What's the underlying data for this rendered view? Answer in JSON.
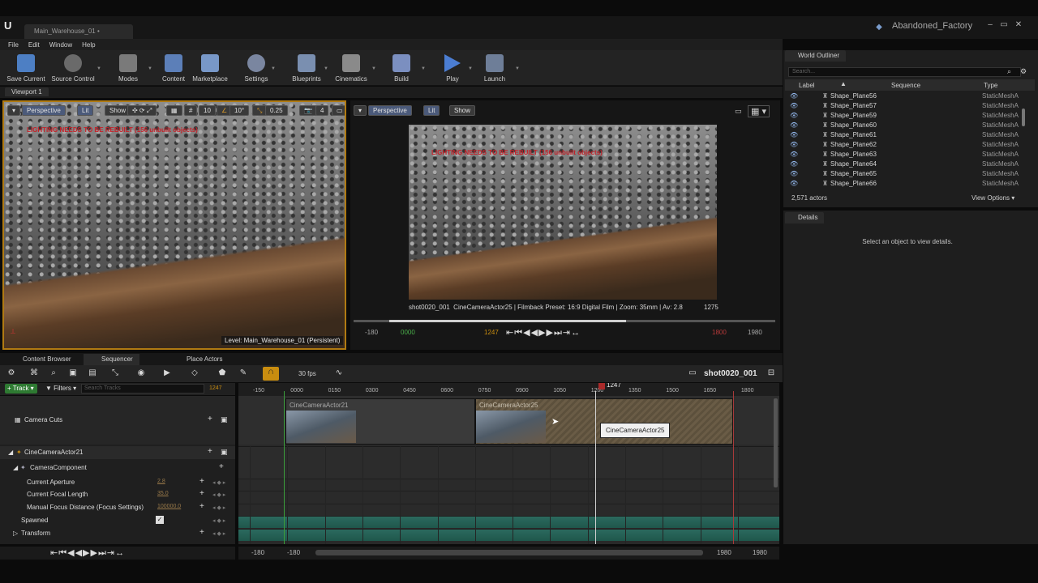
{
  "window": {
    "level_tab": "Main_Warehouse_01 •",
    "project": "Abandoned_Factory"
  },
  "menu": [
    "File",
    "Edit",
    "Window",
    "Help"
  ],
  "toolbar": [
    {
      "label": "Save Current",
      "icon": "save-icon",
      "color": "#4d7fc4"
    },
    {
      "label": "Source Control",
      "icon": "source-control-icon",
      "color": "#6a6a6a"
    },
    {
      "label": "Modes",
      "icon": "modes-icon",
      "color": "#7a7a7a"
    },
    {
      "label": "Content",
      "icon": "content-icon",
      "color": "#5c7fb8"
    },
    {
      "label": "Marketplace",
      "icon": "marketplace-icon",
      "color": "#7898c8"
    },
    {
      "label": "Settings",
      "icon": "settings-icon",
      "color": "#7a86a0"
    },
    {
      "label": "Blueprints",
      "icon": "blueprints-icon",
      "color": "#7a8fb0"
    },
    {
      "label": "Cinematics",
      "icon": "cinematics-icon",
      "color": "#8a8a8a"
    },
    {
      "label": "Build",
      "icon": "build-icon",
      "color": "#7b8fc0"
    },
    {
      "label": "Play",
      "icon": "play-icon",
      "color": "#4b7dd2"
    },
    {
      "label": "Launch",
      "icon": "launch-icon",
      "color": "#6e7e98"
    }
  ],
  "viewport": {
    "tab": "Viewport 1",
    "left": {
      "perspective": "Perspective",
      "lit": "Lit",
      "show": "Show",
      "snap_grid": "10",
      "snap_rot": "10°",
      "snap_scale": "0.25",
      "cam_speed": "4",
      "warning": "LIGHTING NEEDS TO BE REBUILT (156 unbuilt objects)",
      "level_label": "Level:  Main_Warehouse_01 (Persistent)"
    },
    "right": {
      "perspective": "Perspective",
      "lit": "Lit",
      "show": "Show",
      "warning": "LIGHTING NEEDS TO BE REBUILT (156 unbuilt objects)",
      "info_left": "shot0020_001",
      "info_right": "CineCameraActor25 | Filmback Preset: 16:9 Digital Film | Zoom: 35mm | Av: 2.8",
      "frame": "1275",
      "ctrl_start_neg": "-180",
      "ctrl_start": "0000",
      "ctrl_current": "1247",
      "ctrl_end": "1800",
      "ctrl_end_view": "1980",
      "scrub_fraction": 0.73
    }
  },
  "outliner": {
    "title": "World Outliner",
    "search_placeholder": "Search...",
    "col_label": "Label",
    "col_sequence": "Sequence",
    "col_type": "Type",
    "rows": [
      {
        "name": "Shape_Plane56",
        "type": "StaticMeshA"
      },
      {
        "name": "Shape_Plane57",
        "type": "StaticMeshA"
      },
      {
        "name": "Shape_Plane59",
        "type": "StaticMeshA"
      },
      {
        "name": "Shape_Plane60",
        "type": "StaticMeshA"
      },
      {
        "name": "Shape_Plane61",
        "type": "StaticMeshA"
      },
      {
        "name": "Shape_Plane62",
        "type": "StaticMeshA"
      },
      {
        "name": "Shape_Plane63",
        "type": "StaticMeshA"
      },
      {
        "name": "Shape_Plane64",
        "type": "StaticMeshA"
      },
      {
        "name": "Shape_Plane65",
        "type": "StaticMeshA"
      },
      {
        "name": "Shape_Plane66",
        "type": "StaticMeshA"
      }
    ],
    "count": "2,571 actors",
    "view_options": "View Options ▾"
  },
  "details": {
    "title": "Details",
    "empty_msg": "Select an object to view details."
  },
  "sequencer": {
    "tabs": [
      "Content Browser",
      "Sequencer",
      "Place Actors"
    ],
    "fps": "30 fps",
    "sequence_name": "shot0020_001",
    "add_track": "Track",
    "filters": "Filters",
    "search_placeholder": "Search Tracks",
    "frame_field": "1247",
    "tracks": [
      {
        "label": "Camera Cuts",
        "value": ""
      },
      {
        "label": "CineCameraActor21",
        "value": ""
      },
      {
        "label": "CameraComponent",
        "value": ""
      },
      {
        "label": "Current Aperture",
        "value": "2.8"
      },
      {
        "label": "Current Focal Length",
        "value": "35.0"
      },
      {
        "label": "Manual Focus Distance (Focus Settings)",
        "value": "100000.0"
      },
      {
        "label": "Spawned",
        "value": ""
      },
      {
        "label": "Transform",
        "value": ""
      }
    ],
    "ruler_ticks": [
      "-150",
      "0000",
      "0150",
      "0300",
      "0450",
      "0600",
      "0750",
      "0900",
      "1050",
      "1200",
      "1350",
      "1500",
      "1650",
      "1800"
    ],
    "playhead": "1247",
    "shots": [
      {
        "label": "CineCameraActor21"
      },
      {
        "label": "CineCameraActor25"
      }
    ],
    "tooltip": "CineCameraActor25",
    "bottom": {
      "left_neg": "-180",
      "range_start": "-180",
      "range_end": "1980",
      "view_end": "1980"
    }
  },
  "colors": {
    "accent": "#c98d0f",
    "add_track": "#2e7a32",
    "playhead": "#aa2a2a",
    "start": "#3b9f3b",
    "end": "#a83a3a"
  }
}
